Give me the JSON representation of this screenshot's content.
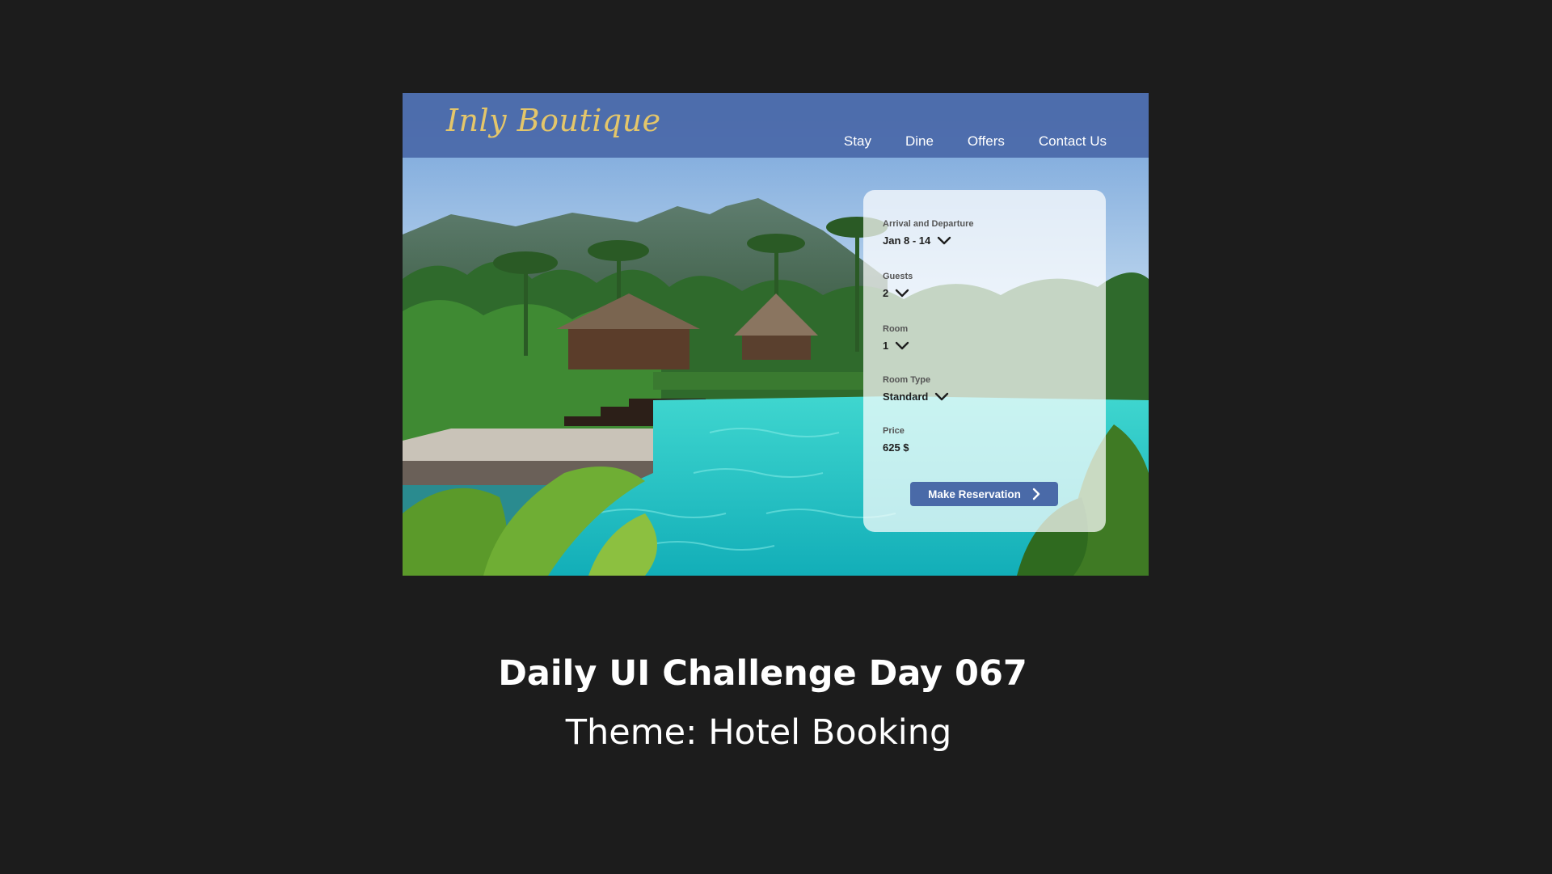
{
  "brand": {
    "logo_text": "Inly Boutique"
  },
  "nav": {
    "items": [
      "Stay",
      "Dine",
      "Offers",
      "Contact Us"
    ]
  },
  "booking": {
    "arrival_label": "Arrival and Departure",
    "arrival_value": "Jan 8 - 14",
    "guests_label": "Guests",
    "guests_value": "2",
    "room_label": "Room",
    "room_value": "1",
    "room_type_label": "Room Type",
    "room_type_value": "Standard",
    "price_label": "Price",
    "price_value": "625 $",
    "reserve_button_label": "Make Reservation"
  },
  "caption": {
    "title": "Daily UI Challenge Day 067",
    "theme": "Theme: Hotel Booking"
  },
  "colors": {
    "page_background": "#1c1c1c",
    "header_blue": "#4a6aa8",
    "logo_gold": "#e4c66a",
    "card_white_translucent": "rgba(255,255,255,0.72)",
    "button_blue": "#4a6aa8",
    "pool_turquoise": "#22c3c4"
  },
  "icons": {
    "dropdown": "chevron-down-icon",
    "button": "chevron-right-icon"
  }
}
